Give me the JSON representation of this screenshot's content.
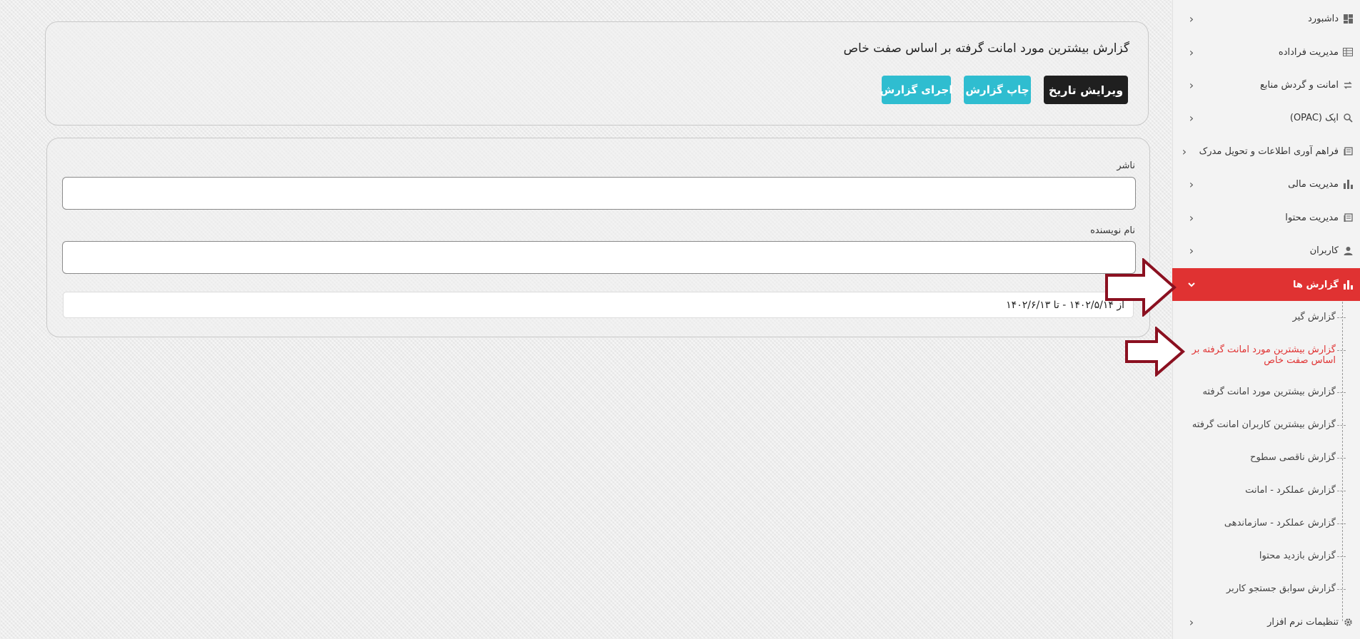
{
  "header": {
    "title": "گزارش بیشترین مورد امانت گرفته بر اساس صفت خاص",
    "buttons": {
      "edit_date": "ویرایش تاریخ",
      "print": "چاپ گزارش",
      "run": "اجرای گزارش"
    }
  },
  "form": {
    "publisher_label": "ناشر",
    "publisher_value": "",
    "author_label": "نام نویسنده",
    "author_value": "",
    "date_range": "از ۱۴۰۲/۵/۱۴ - تا ۱۴۰۲/۶/۱۳"
  },
  "sidebar": {
    "items": [
      {
        "label": "داشبورد",
        "icon": "dashboard-icon"
      },
      {
        "label": "مدیریت فراداده",
        "icon": "table-icon"
      },
      {
        "label": "امانت و گردش منابع",
        "icon": "exchange-icon"
      },
      {
        "label": "اپک (OPAC)",
        "icon": "search-icon"
      },
      {
        "label": "فراهم آوری اطلاعات و تحویل مدرک",
        "icon": "book-icon"
      },
      {
        "label": "مدیریت مالی",
        "icon": "bar-chart-icon"
      },
      {
        "label": "مدیریت محتوا",
        "icon": "book-icon"
      },
      {
        "label": "کاربران",
        "icon": "user-icon"
      },
      {
        "label": "گزارش ها",
        "icon": "bar-chart-icon"
      },
      {
        "label": "تنظیمات نرم افزار",
        "icon": "gear-icon"
      }
    ],
    "report_subitems": [
      "گزارش گیر",
      "گزارش بیشترین مورد امانت گرفته بر اساس صفت خاص",
      "گزارش بیشترین مورد امانت گرفته",
      "گزارش بیشترین کاربران امانت گرفته",
      "گزارش ناقصی سطوح",
      "گزارش عملکرد - امانت",
      "گزارش عملکرد - سازماندهی",
      "گزارش بازدید محتوا",
      "گزارش سوابق جستجو کاربر"
    ]
  },
  "colors": {
    "active_red": "#e03232",
    "accent_cyan": "#2fbdd0",
    "dark_button": "#1f1f1f",
    "annotation_arrow": "#8b1020"
  }
}
